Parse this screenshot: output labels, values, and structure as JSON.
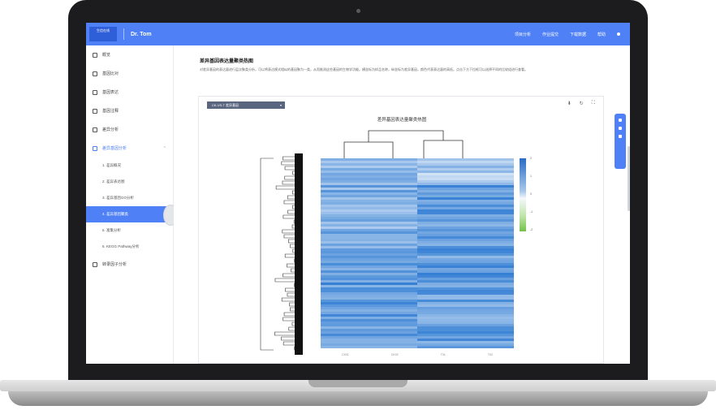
{
  "app": {
    "logo_text": "生信在线",
    "brand": "Dr. Tom"
  },
  "topnav": {
    "items": [
      "项目分析",
      "作业提交",
      "下载数据",
      "帮助"
    ]
  },
  "sidebar": {
    "items": [
      {
        "label": "概览",
        "icon": "home-icon"
      },
      {
        "label": "基因比对",
        "icon": "align-icon"
      },
      {
        "label": "基因表达",
        "icon": "expression-icon"
      },
      {
        "label": "基因注释",
        "icon": "note-icon"
      },
      {
        "label": "差异分析",
        "icon": "diff-icon"
      }
    ],
    "group": {
      "label": "差异基因分析",
      "icon": "chart-icon"
    },
    "sub_items": [
      "1. 差异概况",
      "2. 差异表达图",
      "3. 差异基因GO分析",
      "4. 差异基因聚类",
      "5. 富集分析",
      "6. KEGG Pathway分析"
    ],
    "footer_item": {
      "label": "转录因子分析",
      "icon": "person-icon"
    }
  },
  "main": {
    "title": "差异基因表达量聚类热图",
    "description": "对差异基因的表达量进行层次聚类分析，可以将表达模式相似的基因聚为一类，从而推测这些基因的生物学功能。横坐标为样品名称，纵坐标为差异基因，颜色代表表达量的高低。点击下方下拉框可以选择不同的比较组进行查看。",
    "select_value": "CK-VS-T 差异基因",
    "chart_title": "差异基因表达量聚类热图"
  },
  "chart_data": {
    "type": "heatmap",
    "title": "差异基因表达量聚类热图",
    "columns": [
      "CK01",
      "CK02",
      "T01",
      "T02"
    ],
    "legend_ticks": [
      "2",
      "1",
      "0",
      "-1",
      "-2"
    ],
    "colors": {
      "high": "#2b6cc4",
      "mid": "#f4f8fb",
      "low": "#72c14a"
    }
  },
  "colors": {
    "accent": "#4f80f5"
  }
}
